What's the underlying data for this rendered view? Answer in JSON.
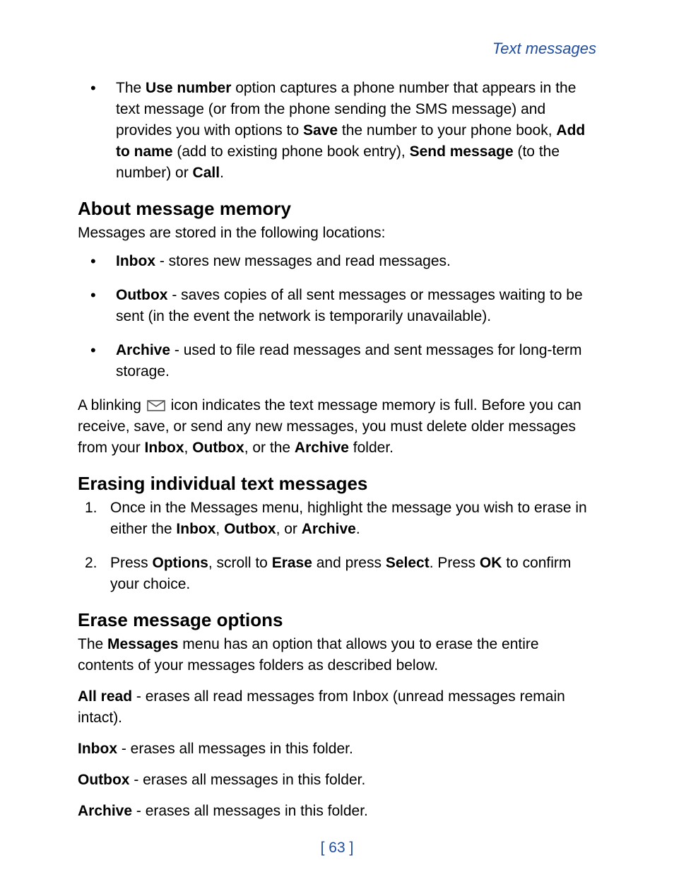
{
  "header": {
    "breadcrumb": "Text messages"
  },
  "intro_bullet": {
    "pre1": "The ",
    "b1": "Use number",
    "mid1": " option captures a phone number that appears in the text message (or from the phone sending the SMS message) and provides you with options to ",
    "b2": "Save",
    "mid2": " the number to your phone book, ",
    "b3": "Add to name",
    "mid3": " (add to existing phone book entry), ",
    "b4": "Send message",
    "mid4": " (to the number) or ",
    "b5": "Call",
    "tail": "."
  },
  "sec1": {
    "title": "About message memory",
    "intro": "Messages are stored in the following locations:",
    "items": [
      {
        "lead": "Inbox",
        "rest": " - stores new messages and read messages."
      },
      {
        "lead": "Outbox",
        "rest": " - saves copies of all sent messages or messages waiting to be sent (in the event the network is temporarily unavailable)."
      },
      {
        "lead": "Archive",
        "rest": " - used to file read messages and sent messages for long-term storage."
      }
    ],
    "blink_pre": "A blinking ",
    "blink_mid": " icon indicates the text message memory is full. Before you can receive, save, or send any new messages, you must delete older messages from your ",
    "blink_b1": "Inbox",
    "blink_sep1": ", ",
    "blink_b2": "Outbox",
    "blink_sep2": ", or the ",
    "blink_b3": "Archive",
    "blink_tail": " folder."
  },
  "sec2": {
    "title": "Erasing individual text messages",
    "steps": [
      {
        "num": "1.",
        "pre": "Once in the Messages menu, highlight the message you wish to erase in either the ",
        "b1": "Inbox",
        "s1": ", ",
        "b2": "Outbox",
        "s2": ", or ",
        "b3": "Archive",
        "tail": "."
      },
      {
        "num": "2.",
        "pre": "Press ",
        "b1": "Options",
        "s1": ", scroll to ",
        "b2": "Erase",
        "s2": " and press ",
        "b3": "Select",
        "s3": ". Press ",
        "b4": "OK",
        "tail": " to confirm your choice."
      }
    ]
  },
  "sec3": {
    "title": "Erase message options",
    "intro_pre": "The ",
    "intro_b": "Messages",
    "intro_post": " menu has an option that allows you to erase the entire contents of your messages folders as described below.",
    "opts": [
      {
        "lead": "All read",
        "rest": " - erases all read messages from Inbox (unread messages remain intact)."
      },
      {
        "lead": "Inbox",
        "rest": " - erases all messages in this folder."
      },
      {
        "lead": "Outbox",
        "rest": " - erases all messages in this folder."
      },
      {
        "lead": "Archive",
        "rest": " - erases all messages in this folder."
      }
    ]
  },
  "footer": {
    "page": "[ 63 ]"
  }
}
